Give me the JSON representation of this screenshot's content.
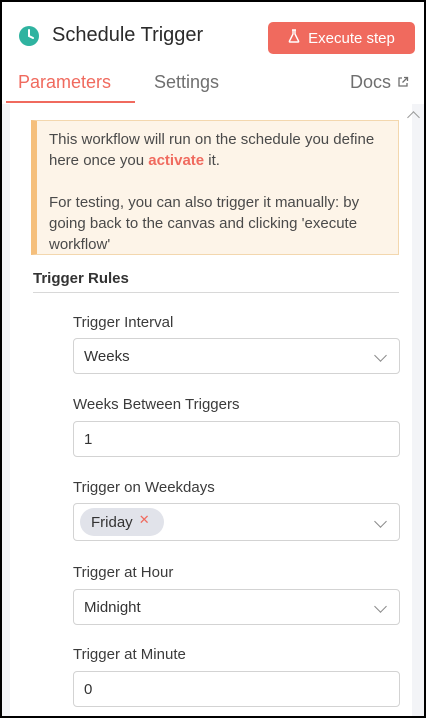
{
  "header": {
    "title": "Schedule Trigger",
    "execute_label": "Execute step",
    "node_icon": "clock-icon",
    "flask_icon": "flask-icon",
    "accent_color": "#f06a5e",
    "node_icon_color": "#2fb3a0"
  },
  "tabs": {
    "parameters": "Parameters",
    "settings": "Settings",
    "docs": "Docs",
    "docs_icon": "external-link-icon",
    "active": "Parameters"
  },
  "notice": {
    "line1_before": "This workflow will run on the schedule you define here once you ",
    "line1_link": "activate",
    "line1_after": " it.",
    "line2": "For testing, you can also trigger it manually: by going back to the canvas and clicking 'execute workflow'"
  },
  "trigger_rules": {
    "title": "Trigger Rules",
    "interval": {
      "label": "Trigger Interval",
      "value": "Weeks"
    },
    "weeks_between": {
      "label": "Weeks Between Triggers",
      "value": "1"
    },
    "weekdays": {
      "label": "Trigger on Weekdays",
      "selected": [
        "Friday"
      ]
    },
    "hour": {
      "label": "Trigger at Hour",
      "value": "Midnight"
    },
    "minute": {
      "label": "Trigger at Minute",
      "value": "0"
    }
  }
}
